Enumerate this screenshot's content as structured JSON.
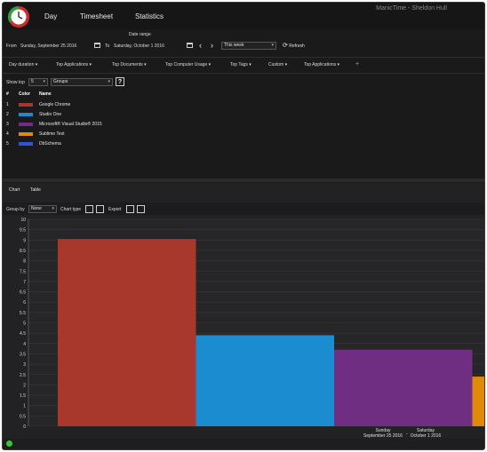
{
  "window": {
    "title": "ManicTime - Sheldon Hull"
  },
  "nav": {
    "day": "Day",
    "timesheet": "Timesheet",
    "statistics": "Statistics"
  },
  "date_range": {
    "heading": "Date range",
    "from_label": "From",
    "from_value": "Sunday, September 25 2016",
    "to_label": "To",
    "to_value": "Saturday, October 1 2016",
    "preset": "This week",
    "refresh_label": "Refresh"
  },
  "report_tabs": [
    "Day duration",
    "Top Applications",
    "Top Documents",
    "Top Computer Usage",
    "Top Tags",
    "Custom",
    "Top Applications"
  ],
  "add_tab": "+",
  "show_top": {
    "label": "Show top",
    "value": "5",
    "group_value": "Groups",
    "help": "?"
  },
  "table": {
    "headers": {
      "num": "#",
      "color": "Color",
      "name": "Name"
    },
    "rows": [
      {
        "num": "1",
        "color": "#a8382b",
        "name": "Google Chrome"
      },
      {
        "num": "2",
        "color": "#1a8ccf",
        "name": "Studio One"
      },
      {
        "num": "3",
        "color": "#6f2e82",
        "name": "Microsoft® Visual Studio® 2015"
      },
      {
        "num": "4",
        "color": "#e08a0c",
        "name": "Sublime Text"
      },
      {
        "num": "5",
        "color": "#2f55d8",
        "name": "DbSchema"
      }
    ]
  },
  "view_tabs": {
    "chart": "Chart",
    "table": "Table"
  },
  "chart_controls": {
    "group_by_label": "Group by",
    "group_by_value": "None",
    "chart_type_label": "Chart type",
    "export_label": "Export"
  },
  "chart_data": {
    "type": "bar",
    "categories": [
      "Google Chrome",
      "Studio One",
      "Microsoft® Visual Studio® 2015",
      "Sublime Text"
    ],
    "values": [
      9.05,
      4.4,
      3.7,
      2.4
    ],
    "colors": [
      "#a8382b",
      "#1a8ccf",
      "#6f2e82",
      "#e08a0c"
    ],
    "ylim": [
      0,
      10
    ],
    "yticks": [
      "0",
      "0.5",
      "1",
      "1.5",
      "2",
      "2.5",
      "3",
      "3.5",
      "4",
      "4.5",
      "5",
      "5.5",
      "6",
      "6.5",
      "7",
      "7.5",
      "8",
      "8.5",
      "9",
      "9.5",
      "10"
    ],
    "xticks": [
      {
        "line1": "Sunday",
        "line2": "September 25 2016"
      },
      {
        "line1": "Saturday",
        "line2": "October 1 2016"
      }
    ],
    "x_separator": "-",
    "grid": true
  },
  "status": {
    "indicator_color": "#37c837"
  }
}
